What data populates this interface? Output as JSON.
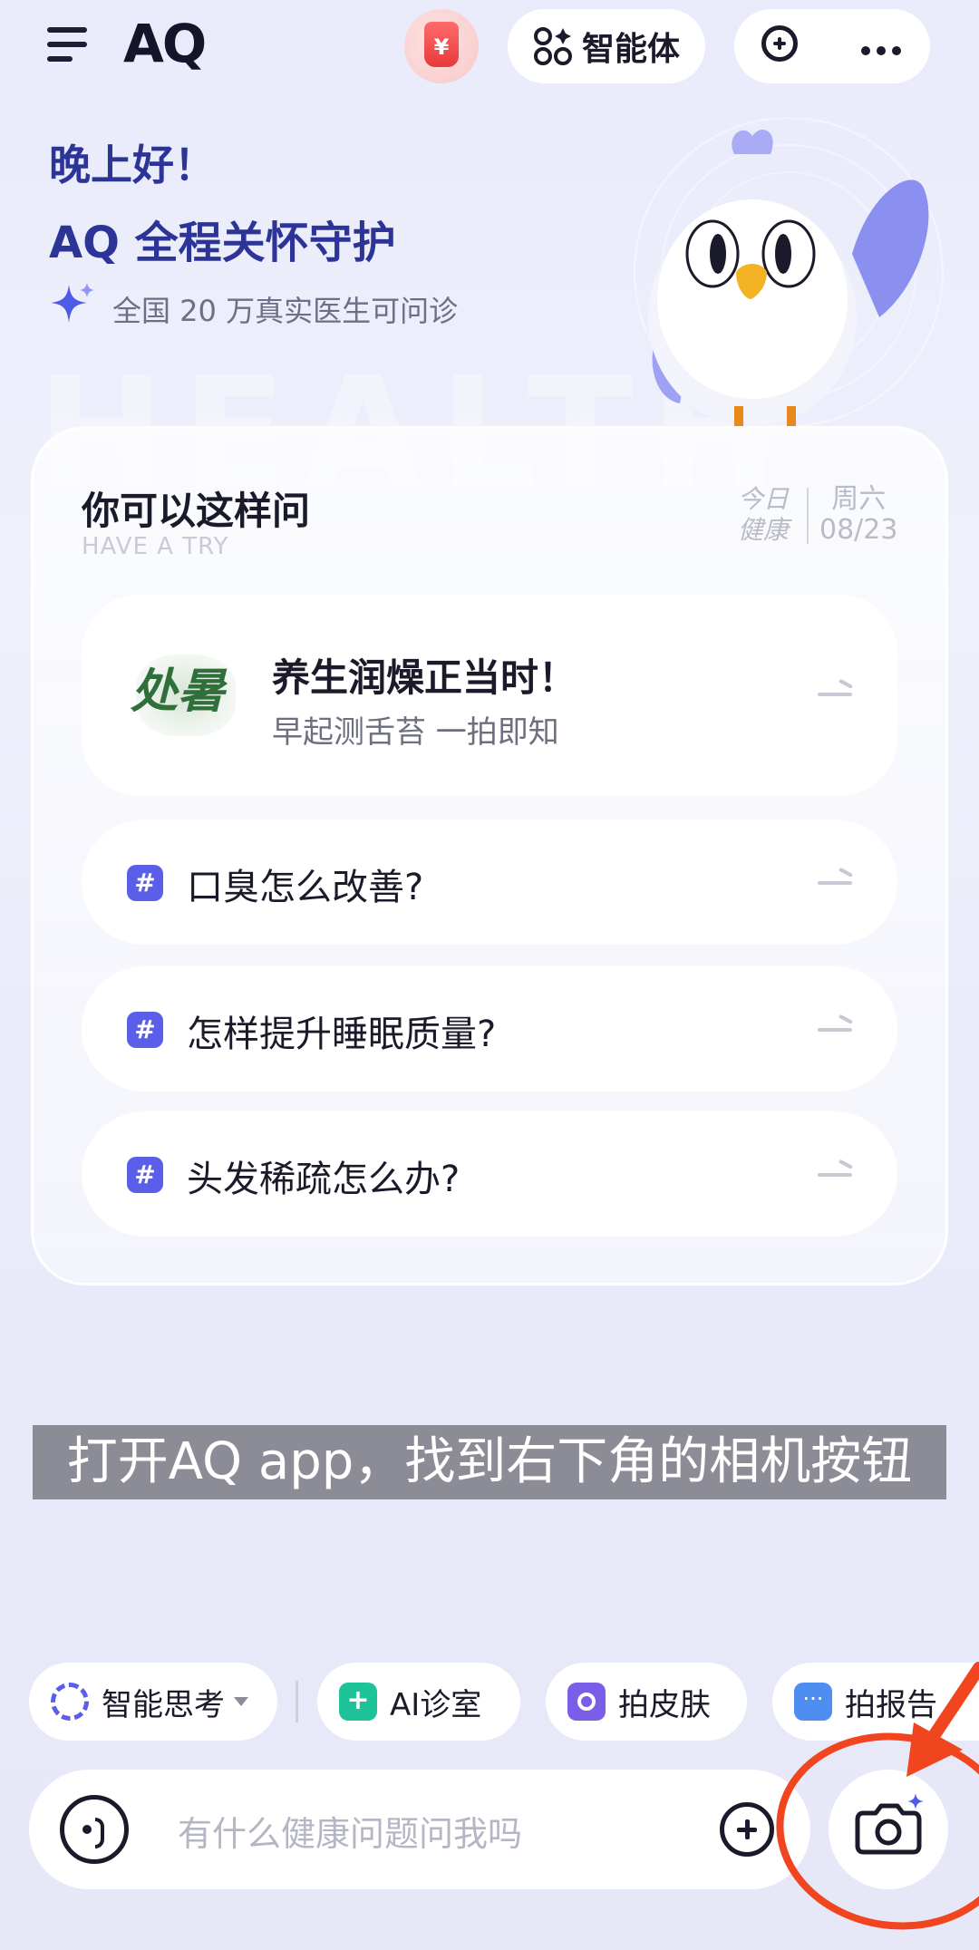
{
  "topbar": {
    "logo": "AQ",
    "coin_symbol": "¥",
    "agent_label": "智能体"
  },
  "greeting": {
    "line1": "晚上好！",
    "line2": "AQ 全程关怀守护",
    "line3": "全国 20 万真实医生可问诊"
  },
  "card": {
    "title": "你可以这样问",
    "subtitle": "HAVE A TRY",
    "date_left_1": "今日",
    "date_left_2": "健康",
    "date_right_1": "周六",
    "date_right_2": "08/23",
    "hero": {
      "badge": "处暑",
      "title": "养生润燥正当时！",
      "subtitle": "早起测舌苔 一拍即知"
    },
    "questions": [
      {
        "text": "口臭怎么改善?"
      },
      {
        "text": "怎样提升睡眠质量?"
      },
      {
        "text": "头发稀疏怎么办?"
      }
    ]
  },
  "caption": "打开AQ app，找到右下角的相机按钮",
  "chips": {
    "think": "智能思考",
    "clinic": "AI诊室",
    "skin": "拍皮肤",
    "report": "拍报告"
  },
  "input": {
    "placeholder": "有什么健康问题问我吗"
  },
  "colors": {
    "brand": "#2d3498",
    "accent": "#5b5ee6",
    "annotation": "#f0451f"
  }
}
